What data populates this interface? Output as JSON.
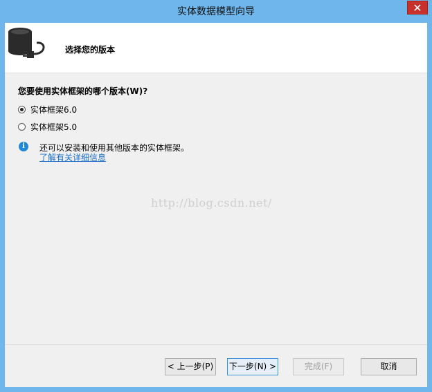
{
  "window": {
    "title": "实体数据模型向导",
    "close_glyph": "✕"
  },
  "header": {
    "title": "选择您的版本",
    "icon": "database-plug-icon"
  },
  "main": {
    "question": "您要使用实体框架的哪个版本(W)?",
    "options": [
      {
        "label": "实体框架6.0",
        "selected": true
      },
      {
        "label": "实体框架5.0",
        "selected": false
      }
    ],
    "info": {
      "icon": "info-icon",
      "text": "还可以安装和使用其他版本的实体框架。",
      "link": "了解有关详细信息"
    }
  },
  "watermark": "http://blog.csdn.net/",
  "buttons": {
    "back": "< 上一步(P)",
    "next": "下一步(N) >",
    "finish": "完成(F)",
    "cancel": "取消"
  },
  "colors": {
    "titlebar": "#6fb6ec",
    "close": "#c7302b",
    "link": "#1a6fc8",
    "info": "#1c8ad8"
  }
}
